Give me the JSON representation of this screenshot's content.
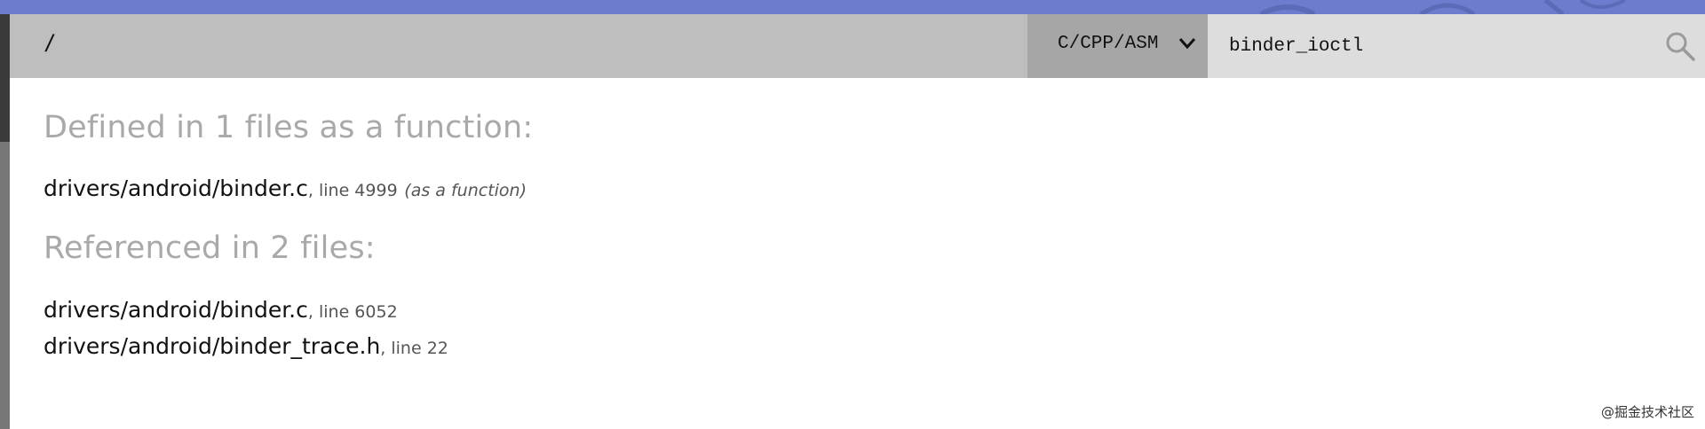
{
  "navbar": {
    "breadcrumb": "/",
    "family": {
      "selected": "C/CPP/ASM",
      "icon": "chevron-down-icon"
    },
    "search": {
      "value": "binder_ioctl",
      "icon": "search-icon"
    }
  },
  "sections": {
    "definitions": {
      "heading": "Defined in 1 files as a function:",
      "results": [
        {
          "path": "drivers/android/binder.c",
          "meta": ", line 4999",
          "kind": "(as a function)"
        }
      ]
    },
    "references": {
      "heading": "Referenced in 2 files:",
      "results": [
        {
          "path": "drivers/android/binder.c",
          "meta": ", line 6052"
        },
        {
          "path": "drivers/android/binder_trace.h",
          "meta": ", line 22"
        }
      ]
    }
  },
  "watermark": "@掘金技术社区",
  "colors": {
    "topbar": "#6d7ccc",
    "navbar": "#bebebe",
    "family_bg": "#a6a6a6",
    "search_bg": "#dddddd",
    "heading": "#a9a9a9"
  }
}
